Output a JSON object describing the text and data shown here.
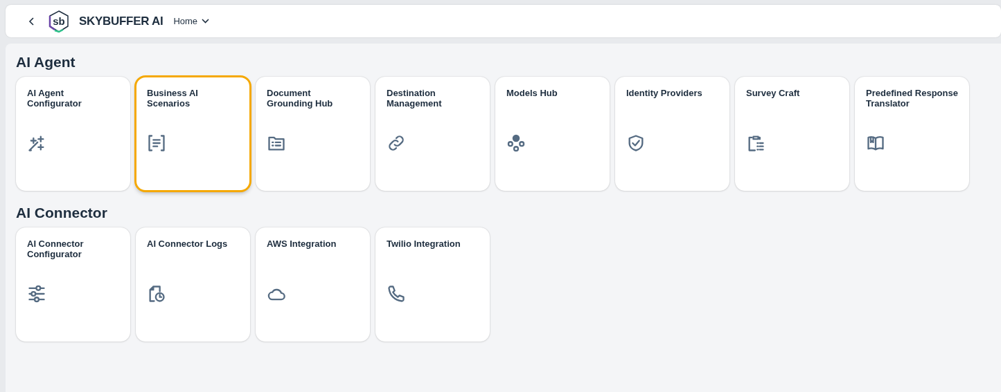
{
  "header": {
    "logo_text": "sb",
    "brand": "SKYBUFFER AI",
    "menu": "Home"
  },
  "sections": [
    {
      "title": "AI Agent",
      "tiles": [
        {
          "title": "AI Agent Configurator",
          "focused": false
        },
        {
          "title": "Business AI Scenarios",
          "focused": true
        },
        {
          "title": "Document Grounding Hub",
          "focused": false
        },
        {
          "title": "Destination Management",
          "focused": false
        },
        {
          "title": "Models Hub",
          "focused": false
        },
        {
          "title": "Identity Providers",
          "focused": false
        },
        {
          "title": "Survey Craft",
          "focused": false
        },
        {
          "title": "Predefined Response Translator",
          "focused": false
        }
      ]
    },
    {
      "title": "AI Connector",
      "tiles": [
        {
          "title": "AI Connector Configurator",
          "focused": false
        },
        {
          "title": "AI Connector Logs",
          "focused": false
        },
        {
          "title": "AWS Integration",
          "focused": false
        },
        {
          "title": "Twilio Integration",
          "focused": false
        }
      ]
    }
  ]
}
